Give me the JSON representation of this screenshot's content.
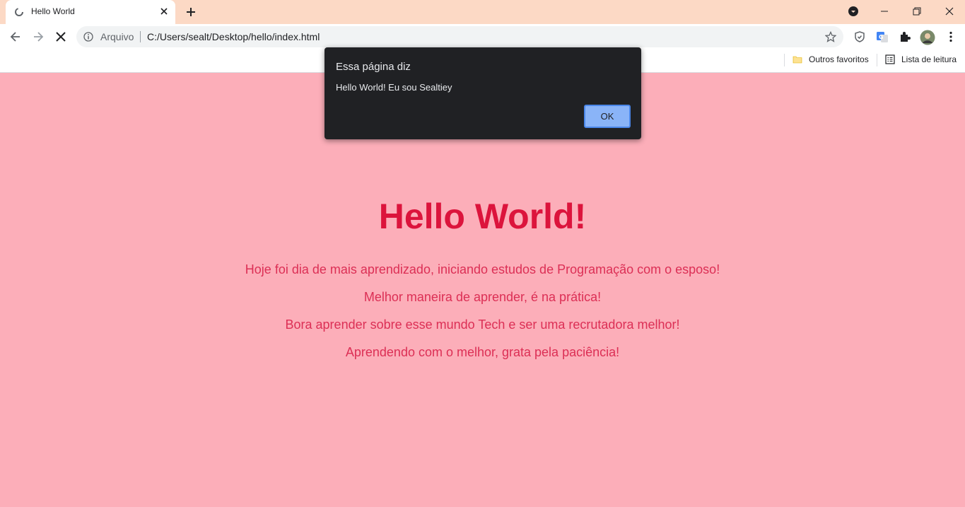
{
  "browser": {
    "tab": {
      "title": "Hello World",
      "favicon": "loading-spinner-icon"
    },
    "new_tab_icon": "plus-icon",
    "window_controls": [
      "minimize-icon",
      "restore-icon",
      "close-icon"
    ],
    "profile_menu_icon": "chevron-down-circle-icon"
  },
  "toolbar": {
    "back_icon": "arrow-left-icon",
    "forward_icon": "arrow-right-icon",
    "stop_icon": "stop-loading-icon",
    "omnibox": {
      "scheme_label": "Arquivo",
      "url": "C:/Users/sealt/Desktop/hello/index.html",
      "info_icon": "info-circle-icon",
      "bookmark_icon": "star-icon"
    },
    "extensions": [
      "shield-icon",
      "translate-icon",
      "puzzle-icon",
      "avatar",
      "kebab-menu-icon"
    ]
  },
  "bookmarks_bar": {
    "items": [
      {
        "label": "Outros favoritos",
        "icon": "folder-icon"
      },
      {
        "label": "Lista de leitura",
        "icon": "reading-list-icon"
      }
    ]
  },
  "page": {
    "background": "#fcaeb9",
    "heading": "Hello World!",
    "heading_color": "#dc143c",
    "paragraphs": [
      "Hoje foi dia de mais aprendizado, iniciando estudos de Programação com o esposo!",
      "Melhor maneira de aprender, é na prática!",
      "Bora aprender sobre esse mundo Tech e ser uma recrutadora melhor!",
      "Aprendendo com o melhor, grata pela paciência!"
    ]
  },
  "alert_dialog": {
    "title": "Essa página diz",
    "message": "Hello World! Eu sou Sealtiey",
    "ok_label": "OK"
  }
}
